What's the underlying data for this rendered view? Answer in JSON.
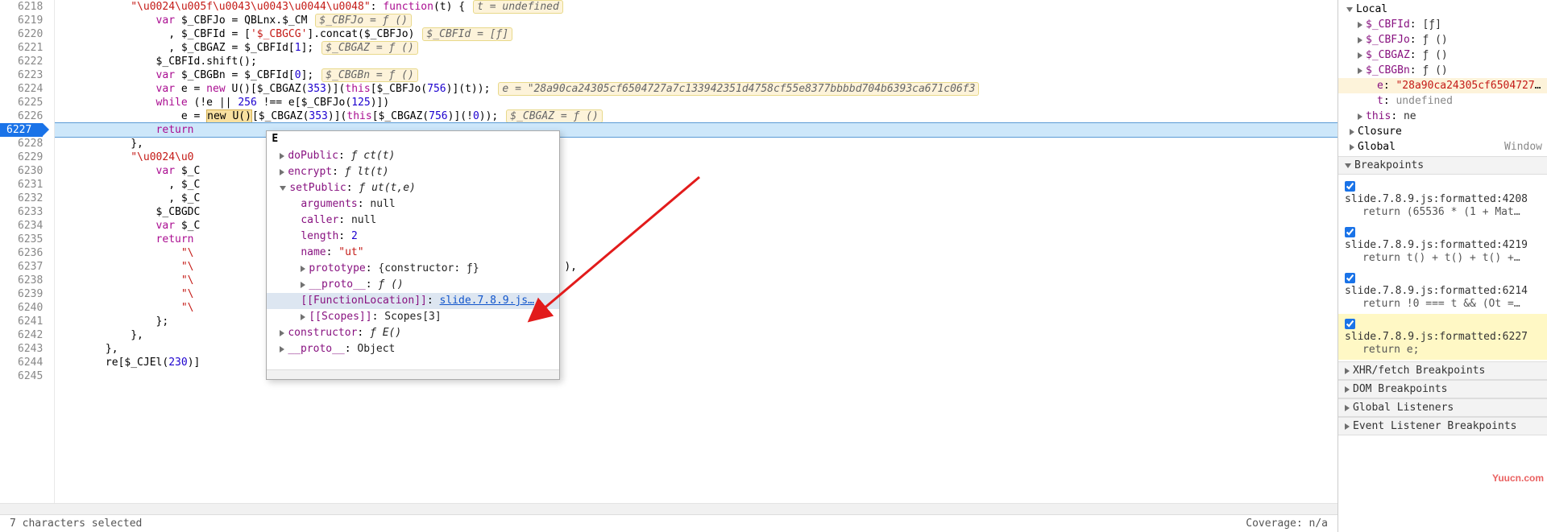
{
  "gutter": {
    "start": 6218,
    "end": 6245,
    "active": 6227
  },
  "lines": [
    {
      "n": 6218,
      "segs": [
        [
          "            ",
          ""
        ],
        [
          "\"\\u0024\\u005f\\u0043\\u0043\\u0044\\u0048\"",
          "str"
        ],
        [
          ": ",
          "fn"
        ],
        [
          "function",
          "kw"
        ],
        [
          "(t) {",
          ""
        ]
      ],
      "watch": "t = undefined"
    },
    {
      "n": 6219,
      "segs": [
        [
          "                ",
          ""
        ],
        [
          "var",
          "kw"
        ],
        [
          " $_CBFJo = QBLnx.$_CM",
          ""
        ]
      ],
      "watch": "$_CBFJo = ƒ ()"
    },
    {
      "n": 6220,
      "segs": [
        [
          "                  , $_CBFId = [",
          ""
        ],
        [
          "'$_CBGCG'",
          "str"
        ],
        [
          "].concat($_CBFJo)",
          ""
        ]
      ],
      "watch": "$_CBFId = [ƒ]"
    },
    {
      "n": 6221,
      "segs": [
        [
          "                  , $_CBGAZ = $_CBFId[",
          ""
        ],
        [
          "1",
          "num"
        ],
        [
          "];",
          ""
        ]
      ],
      "watch": "$_CBGAZ = ƒ ()"
    },
    {
      "n": 6222,
      "segs": [
        [
          "                $_CBFId.shift();",
          ""
        ]
      ]
    },
    {
      "n": 6223,
      "segs": [
        [
          "                ",
          ""
        ],
        [
          "var",
          "kw"
        ],
        [
          " $_CBGBn = $_CBFId[",
          ""
        ],
        [
          "0",
          "num"
        ],
        [
          "];",
          ""
        ]
      ],
      "watch": "$_CBGBn = ƒ ()"
    },
    {
      "n": 6224,
      "segs": [
        [
          "                ",
          ""
        ],
        [
          "var",
          "kw"
        ],
        [
          " e = ",
          ""
        ],
        [
          "new",
          "kw"
        ],
        [
          " U()[$_CBGAZ(",
          ""
        ],
        [
          "353",
          "num"
        ],
        [
          ")](",
          ""
        ],
        [
          "this",
          "kw"
        ],
        [
          "[$_CBFJo(",
          ""
        ],
        [
          "756",
          "num"
        ],
        [
          ")](t));",
          ""
        ]
      ],
      "watch": "e = \"28a90ca24305cf6504727a7c133942351d4758cf55e8377bbbbd704b6393ca671c06f3"
    },
    {
      "n": 6225,
      "segs": [
        [
          "                ",
          ""
        ],
        [
          "while",
          "kw"
        ],
        [
          " (!e || ",
          ""
        ],
        [
          "256",
          "num"
        ],
        [
          " !== e[$_CBFJo(",
          ""
        ],
        [
          "125",
          "num"
        ],
        [
          ")])",
          ""
        ]
      ]
    },
    {
      "n": 6226,
      "segs": [
        [
          "                    e = ",
          ""
        ],
        [
          "new U()",
          "hl-new"
        ],
        [
          "[$_CBGAZ(",
          ""
        ],
        [
          "353",
          "num"
        ],
        [
          ")](",
          ""
        ],
        [
          "this",
          "kw"
        ],
        [
          "[$_CBGAZ(",
          ""
        ],
        [
          "756",
          "num"
        ],
        [
          ")](!",
          ""
        ],
        [
          "0",
          "num"
        ],
        [
          "));",
          ""
        ]
      ],
      "watch": "$_CBGAZ = ƒ ()"
    },
    {
      "n": 6227,
      "segs": [
        [
          "                ",
          ""
        ],
        [
          "return",
          "kw"
        ],
        [
          " ",
          ""
        ]
      ],
      "paused": true
    },
    {
      "n": 6228,
      "segs": [
        [
          "            },",
          ""
        ]
      ]
    },
    {
      "n": 6229,
      "segs": [
        [
          "            ",
          ""
        ],
        [
          "\"\\u0024\\u0",
          "str"
        ]
      ]
    },
    {
      "n": 6230,
      "segs": [
        [
          "                ",
          ""
        ],
        [
          "var",
          "kw"
        ],
        [
          " $_C",
          ""
        ]
      ]
    },
    {
      "n": 6231,
      "segs": [
        [
          "                  , $_C",
          ""
        ]
      ]
    },
    {
      "n": 6232,
      "segs": [
        [
          "                  , $_C",
          ""
        ]
      ]
    },
    {
      "n": 6233,
      "segs": [
        [
          "                $_CBGDC",
          ""
        ]
      ]
    },
    {
      "n": 6234,
      "segs": [
        [
          "                ",
          ""
        ],
        [
          "var",
          "kw"
        ],
        [
          " $_C",
          ""
        ]
      ]
    },
    {
      "n": 6235,
      "segs": [
        [
          "                ",
          ""
        ],
        [
          "return",
          "kw"
        ]
      ]
    },
    {
      "n": 6236,
      "segs": [
        [
          "                    ",
          ""
        ],
        [
          "\"\\",
          "str"
        ]
      ]
    },
    {
      "n": 6237,
      "segs": [
        [
          "                    ",
          ""
        ],
        [
          "\"\\",
          "str"
        ]
      ],
      "after": "),"
    },
    {
      "n": 6238,
      "segs": [
        [
          "                    ",
          ""
        ],
        [
          "\"\\",
          "str"
        ]
      ]
    },
    {
      "n": 6239,
      "segs": [
        [
          "                    ",
          ""
        ],
        [
          "\"\\",
          "str"
        ]
      ]
    },
    {
      "n": 6240,
      "segs": [
        [
          "                    ",
          ""
        ],
        [
          "\"\\",
          "str"
        ]
      ]
    },
    {
      "n": 6241,
      "segs": [
        [
          "                };",
          ""
        ]
      ]
    },
    {
      "n": 6242,
      "segs": [
        [
          "            },",
          ""
        ]
      ]
    },
    {
      "n": 6243,
      "segs": [
        [
          "        },",
          ""
        ]
      ]
    },
    {
      "n": 6244,
      "segs": [
        [
          "        re[$_CJEl(",
          ""
        ],
        [
          "230",
          "num"
        ],
        [
          ")]",
          ""
        ]
      ]
    },
    {
      "n": 6245,
      "segs": [
        [
          "",
          ""
        ]
      ]
    }
  ],
  "popup": {
    "title": "E",
    "rows": [
      {
        "k": "doPublic",
        "v": "ƒ ct(t)",
        "exp": "c"
      },
      {
        "k": "encrypt",
        "v": "ƒ lt(t)",
        "exp": "c"
      },
      {
        "k": "setPublic",
        "v": "ƒ ut(t,e)",
        "exp": "e"
      },
      {
        "k": "arguments",
        "v": "null",
        "sub": true
      },
      {
        "k": "caller",
        "v": "null",
        "sub": true
      },
      {
        "k": "length",
        "v": "2",
        "sub": true,
        "num": true
      },
      {
        "k": "name",
        "v": "\"ut\"",
        "sub": true,
        "str": true
      },
      {
        "k": "prototype",
        "v": "{constructor: ƒ}",
        "sub": true,
        "exp": "c"
      },
      {
        "k": "__proto__",
        "v": "ƒ ()",
        "sub": true,
        "exp": "c"
      },
      {
        "k": "[[FunctionLocation]]",
        "v": "slide.7.8.9.js…",
        "sub": true,
        "link": true,
        "sel": true
      },
      {
        "k": "[[Scopes]]",
        "v": "Scopes[3]",
        "sub": true,
        "exp": "c"
      },
      {
        "k": "constructor",
        "v": "ƒ E()",
        "exp": "c"
      },
      {
        "k": "__proto__",
        "v": "Object",
        "exp": "c"
      }
    ]
  },
  "scope": {
    "local_label": "Local",
    "rows": [
      {
        "k": "$_CBFId",
        "v": "[ƒ]",
        "tri": true
      },
      {
        "k": "$_CBFJo",
        "v": "ƒ ()",
        "tri": true
      },
      {
        "k": "$_CBGAZ",
        "v": "ƒ ()",
        "tri": true
      },
      {
        "k": "$_CBGBn",
        "v": "ƒ ()",
        "tri": true,
        "exp": true
      },
      {
        "k": "e",
        "v": "\"28a90ca24305cf6504727a…",
        "indent": true,
        "hl": true,
        "str": true
      },
      {
        "k": "t",
        "v": "undefined",
        "indent": true,
        "dim": true
      },
      {
        "k": "this",
        "v": "ne",
        "tri": true
      }
    ],
    "closure": "Closure",
    "global": "Global",
    "global_v": "Window"
  },
  "breakpoints": {
    "header": "Breakpoints",
    "items": [
      {
        "loc": "slide.7.8.9.js:formatted:4208",
        "src": "return (65536 * (1 + Mat…",
        "checked": true
      },
      {
        "loc": "slide.7.8.9.js:formatted:4219",
        "src": "return t() + t() + t() +…",
        "checked": true
      },
      {
        "loc": "slide.7.8.9.js:formatted:6214",
        "src": "return !0 === t && (Ot =…",
        "checked": true
      },
      {
        "loc": "slide.7.8.9.js:formatted:6227",
        "src": "return e;",
        "checked": true,
        "active": true
      }
    ]
  },
  "sections": {
    "xhr": "XHR/fetch Breakpoints",
    "dom": "DOM Breakpoints",
    "gl": "Global Listeners",
    "evl": "Event Listener Breakpoints"
  },
  "status": {
    "left": "7 characters selected",
    "right": "Coverage: n/a"
  },
  "watermark": "Yuucn.com"
}
